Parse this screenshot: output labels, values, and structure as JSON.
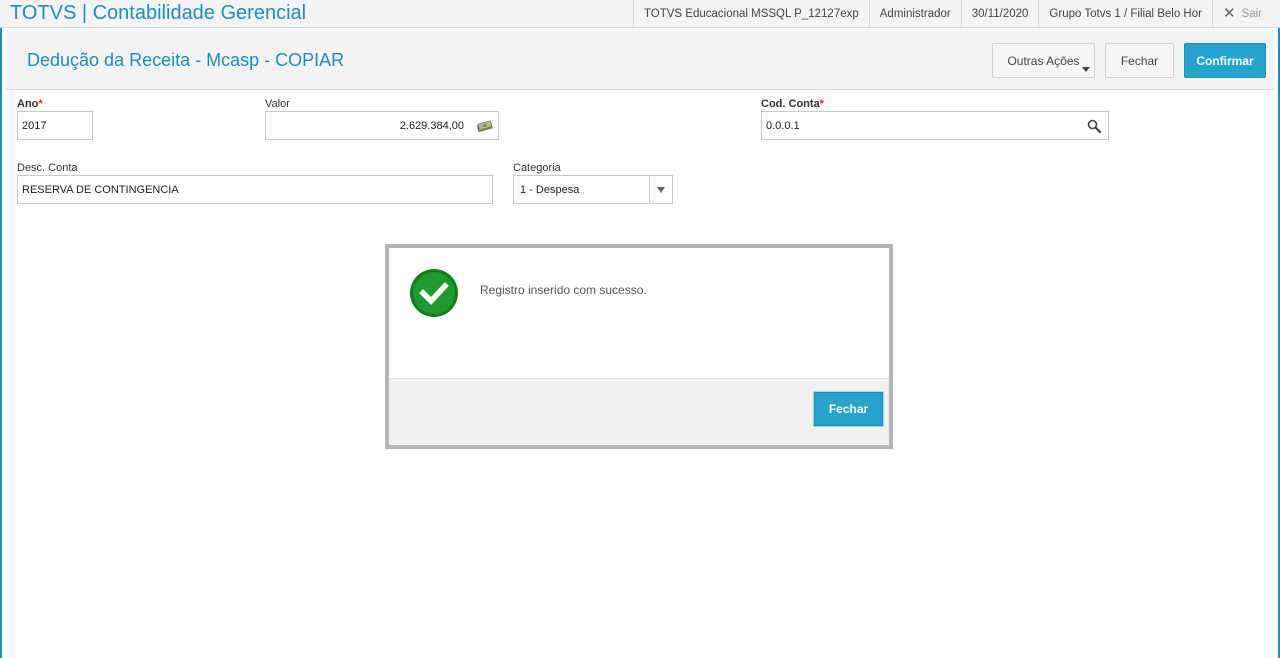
{
  "app": {
    "title": "TOTVS | Contabilidade Gerencial"
  },
  "topbar": {
    "environment": "TOTVS Educacional MSSQL P_12127exp",
    "user": "Administrador",
    "date": "30/11/2020",
    "company": "Grupo Totvs 1 / Filial Belo Hor",
    "exit_label": "Sair"
  },
  "header": {
    "title": "Dedução da Receita - Mcasp - COPIAR",
    "more_actions_label": "Outras Ações",
    "close_label": "Fechar",
    "confirm_label": "Confirmar"
  },
  "form": {
    "ano": {
      "label": "Ano",
      "required_mark": "*",
      "value": "2017"
    },
    "valor": {
      "label": "Valor",
      "value": "2.629.384,00"
    },
    "cod_conta": {
      "label": "Cod. Conta",
      "required_mark": "*",
      "value": "0.0.0.1"
    },
    "desc_conta": {
      "label": "Desc. Conta",
      "value": "RESERVA DE CONTINGENCIA"
    },
    "categoria": {
      "label": "Categoria",
      "value": "1 - Despesa"
    }
  },
  "modal": {
    "message": "Registro inserido com sucesso.",
    "close_label": "Fechar",
    "status_color": "#1e9b2c"
  },
  "colors": {
    "accent": "#1a8fc1",
    "primary_button": "#26a3cf",
    "required": "#d9261c"
  }
}
